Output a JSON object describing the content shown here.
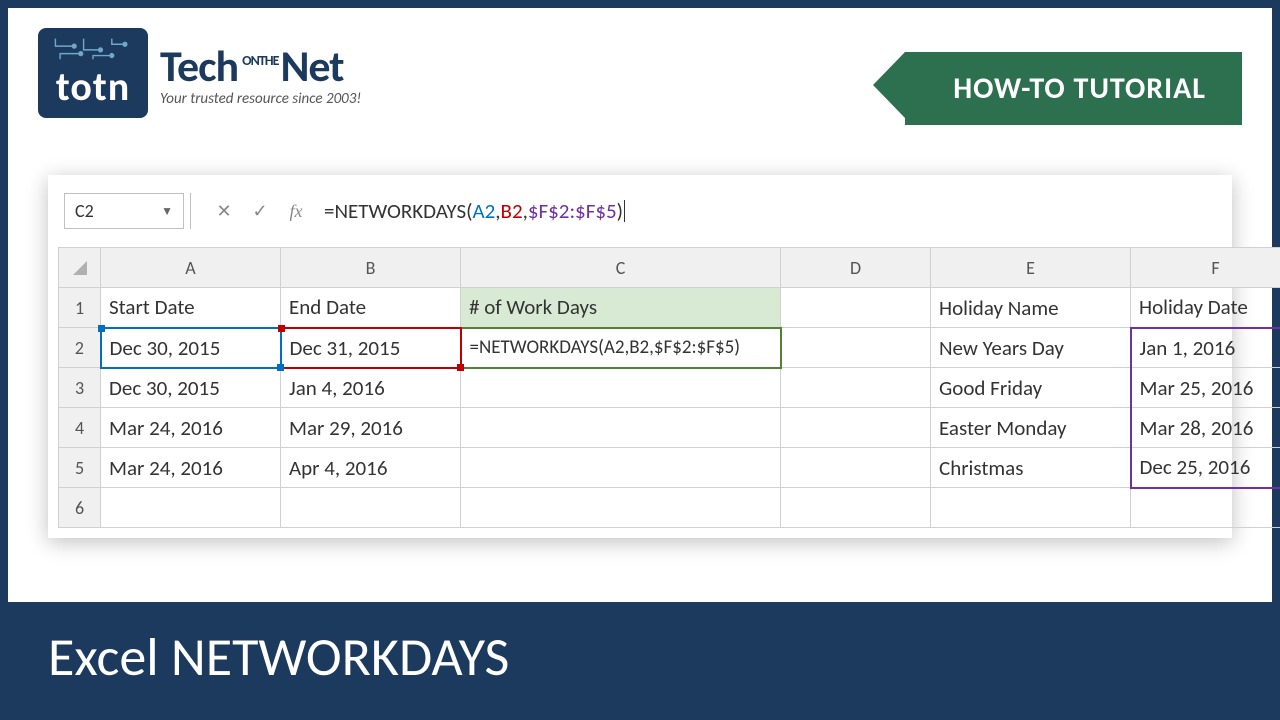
{
  "header": {
    "logo_text": "totn",
    "brand_tech": "Tech",
    "brand_on": "ON",
    "brand_the": "THE",
    "brand_net": "Net",
    "tagline": "Your trusted resource since 2003!",
    "ribbon": "HOW-TO TUTORIAL"
  },
  "formula_bar": {
    "name_box": "C2",
    "formula_prefix": "=NETWORKDAYS(",
    "ref_a": "A2",
    "ref_b": "B2",
    "ref_f": "$F$2:$F$5",
    "formula_close": ")"
  },
  "columns": [
    "A",
    "B",
    "C",
    "D",
    "E",
    "F"
  ],
  "rows": [
    "1",
    "2",
    "3",
    "4",
    "5",
    "6"
  ],
  "cells": {
    "A1": "Start Date",
    "B1": "End Date",
    "C1": "# of Work Days",
    "E1": "Holiday Name",
    "F1": "Holiday Date",
    "A2": "Dec 30, 2015",
    "B2": "Dec 31, 2015",
    "C2": "=NETWORKDAYS(A2,B2,$F$2:$F$5)",
    "E2": "New Years Day",
    "F2": "Jan 1, 2016",
    "A3": "Dec 30, 2015",
    "B3": "Jan 4, 2016",
    "E3": "Good Friday",
    "F3": "Mar 25, 2016",
    "A4": "Mar 24, 2016",
    "B4": "Mar 29, 2016",
    "E4": "Easter Monday",
    "F4": "Mar 28, 2016",
    "A5": "Mar 24, 2016",
    "B5": "Apr 4, 2016",
    "E5": "Christmas",
    "F5": "Dec 25, 2016"
  },
  "footer": "Excel NETWORKDAYS"
}
